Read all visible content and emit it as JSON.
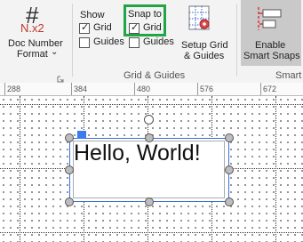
{
  "ribbon": {
    "doc_number": {
      "icon_glyph": "#",
      "sample": "N.x2",
      "label_line1": "Doc Number",
      "label_line2": "Format",
      "dropdown_glyph": "⌄"
    },
    "show": {
      "title": "Show",
      "grid_label": "Grid",
      "grid_checked": true,
      "guides_label": "Guides",
      "guides_checked": false
    },
    "snap_to": {
      "title": "Snap to",
      "grid_label": "Grid",
      "grid_checked": true,
      "guides_label": "Guides",
      "guides_checked": false,
      "highlight_color": "#20a646"
    },
    "setup": {
      "label_line1": "Setup Grid",
      "label_line2": "& Guides"
    },
    "enable": {
      "label_line1": "Enable",
      "label_line2": "Smart Snaps"
    },
    "group_grid_guides": "Grid & Guides",
    "group_smart": "Smart"
  },
  "ruler": {
    "labels": [
      "288",
      "384",
      "480",
      "576",
      "672"
    ]
  },
  "canvas": {
    "text": "Hello, World!"
  },
  "colors": {
    "selection": "#3a6fd8",
    "anchor": "#3a7cf0"
  }
}
